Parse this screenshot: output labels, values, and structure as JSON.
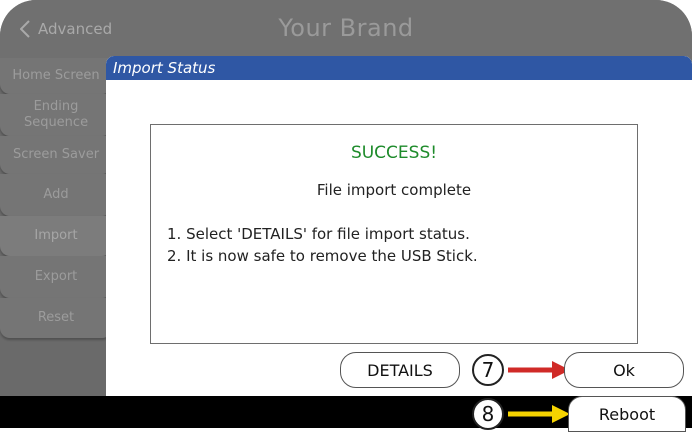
{
  "header": {
    "back_label": "Advanced",
    "brand": "Your Brand"
  },
  "sidebar": {
    "items": [
      {
        "label": "Home Screen"
      },
      {
        "label": "Ending Sequence"
      },
      {
        "label": "Screen Saver"
      },
      {
        "label": "Add"
      },
      {
        "label": "Import"
      },
      {
        "label": "Export"
      },
      {
        "label": "Reset"
      }
    ]
  },
  "dialog": {
    "title": "Import Status",
    "success": "SUCCESS!",
    "complete": "File import complete",
    "steps": [
      "1.  Select 'DETAILS' for file import status.",
      "2.  It is now safe to remove the USB Stick."
    ],
    "details_label": "DETAILS",
    "ok_label": "Ok"
  },
  "footer": {
    "reboot_label": "Reboot"
  },
  "annotations": {
    "marker_7": "7",
    "marker_8": "8",
    "arrow_7_color": "#d02a27",
    "arrow_8_color": "#f5d300"
  },
  "colors": {
    "dialog_title_bar": "#2f57a4",
    "success_text": "#1e8b2b"
  }
}
